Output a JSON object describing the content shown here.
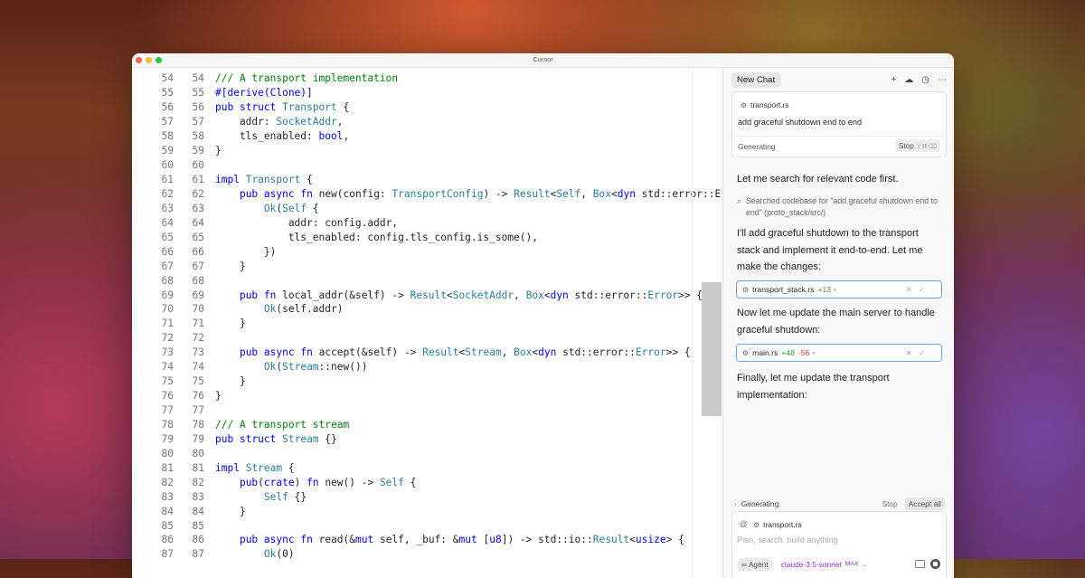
{
  "window": {
    "title": "Cursor"
  },
  "colors": {
    "keyword": "#0000ff",
    "type": "#267f99",
    "comment": "#008000",
    "function": "#795e26",
    "accent_model": "#8a2be2",
    "add": "#2e9a3a",
    "del": "#dd3333",
    "chip_border": "#6aa6e8"
  },
  "editor": {
    "lines": [
      {
        "n1": "54",
        "n2": "54",
        "text": "/// A transport implementation"
      },
      {
        "n1": "55",
        "n2": "55",
        "text": "#[derive(Clone)]"
      },
      {
        "n1": "56",
        "n2": "56",
        "text": "pub struct Transport {"
      },
      {
        "n1": "57",
        "n2": "57",
        "text": "    addr: SocketAddr,"
      },
      {
        "n1": "58",
        "n2": "58",
        "text": "    tls_enabled: bool,"
      },
      {
        "n1": "59",
        "n2": "59",
        "text": "}"
      },
      {
        "n1": "60",
        "n2": "60",
        "text": ""
      },
      {
        "n1": "61",
        "n2": "61",
        "text": "impl Transport {"
      },
      {
        "n1": "62",
        "n2": "62",
        "text": "    pub async fn new(config: TransportConfig) -> Result<Self, Box<dyn std::error::Er"
      },
      {
        "n1": "63",
        "n2": "63",
        "text": "        Ok(Self {"
      },
      {
        "n1": "64",
        "n2": "64",
        "text": "            addr: config.addr,"
      },
      {
        "n1": "65",
        "n2": "65",
        "text": "            tls_enabled: config.tls_config.is_some(),"
      },
      {
        "n1": "66",
        "n2": "66",
        "text": "        })"
      },
      {
        "n1": "67",
        "n2": "67",
        "text": "    }"
      },
      {
        "n1": "68",
        "n2": "68",
        "text": ""
      },
      {
        "n1": "69",
        "n2": "69",
        "text": "    pub fn local_addr(&self) -> Result<SocketAddr, Box<dyn std::error::Error>> {"
      },
      {
        "n1": "70",
        "n2": "70",
        "text": "        Ok(self.addr)"
      },
      {
        "n1": "71",
        "n2": "71",
        "text": "    }"
      },
      {
        "n1": "72",
        "n2": "72",
        "text": ""
      },
      {
        "n1": "73",
        "n2": "73",
        "text": "    pub async fn accept(&self) -> Result<Stream, Box<dyn std::error::Error>> {"
      },
      {
        "n1": "74",
        "n2": "74",
        "text": "        Ok(Stream::new())"
      },
      {
        "n1": "75",
        "n2": "75",
        "text": "    }"
      },
      {
        "n1": "76",
        "n2": "76",
        "text": "}"
      },
      {
        "n1": "77",
        "n2": "77",
        "text": ""
      },
      {
        "n1": "78",
        "n2": "78",
        "text": "/// A transport stream"
      },
      {
        "n1": "79",
        "n2": "79",
        "text": "pub struct Stream {}"
      },
      {
        "n1": "80",
        "n2": "80",
        "text": ""
      },
      {
        "n1": "81",
        "n2": "81",
        "text": "impl Stream {"
      },
      {
        "n1": "82",
        "n2": "82",
        "text": "    pub(crate) fn new() -> Self {"
      },
      {
        "n1": "83",
        "n2": "83",
        "text": "        Self {}"
      },
      {
        "n1": "84",
        "n2": "84",
        "text": "    }"
      },
      {
        "n1": "85",
        "n2": "85",
        "text": ""
      },
      {
        "n1": "86",
        "n2": "86",
        "text": "    pub async fn read(&mut self, _buf: &mut [u8]) -> std::io::Result<usize> {"
      },
      {
        "n1": "87",
        "n2": "87",
        "text": "        Ok(0)"
      }
    ]
  },
  "chat": {
    "tab_label": "New Chat",
    "header_icons": [
      "plus-icon",
      "cloud-icon",
      "history-icon",
      "more-icon"
    ],
    "header_glyphs": [
      "+",
      "☁",
      "◷",
      "⋯"
    ],
    "request": {
      "file": "transport.rs",
      "message": "add graceful shutdown end to end",
      "status": "Generating",
      "stop_label": "Stop",
      "stop_shortcut": "⇧⌘⌫"
    },
    "messages": {
      "m1": "Let me search for relevant code first.",
      "search": "Searched codebase for \"add graceful shutdown end to end\" (proto_stack/src/)",
      "m2": "I'll add graceful shutdown to the transport stack and implement it end-to-end. Let me make the changes:",
      "m3": "Now let me update the main server to handle graceful shutdown:",
      "m4": "Finally, let me update the transport implementation:"
    },
    "diff1": {
      "file": "transport_stack.rs",
      "add": "+13",
      "del": ""
    },
    "diff2": {
      "file": "main.rs",
      "add": "+48",
      "del": "-56"
    },
    "gen_bar": {
      "label": "Generating.",
      "stop": "Stop",
      "accept": "Accept all"
    },
    "composer": {
      "at": "@",
      "file": "transport.rs",
      "placeholder": "Plan, search, build anything",
      "agent": "∞ Agent",
      "model": "claude-3.5-sonnet",
      "max": "MAX"
    }
  }
}
